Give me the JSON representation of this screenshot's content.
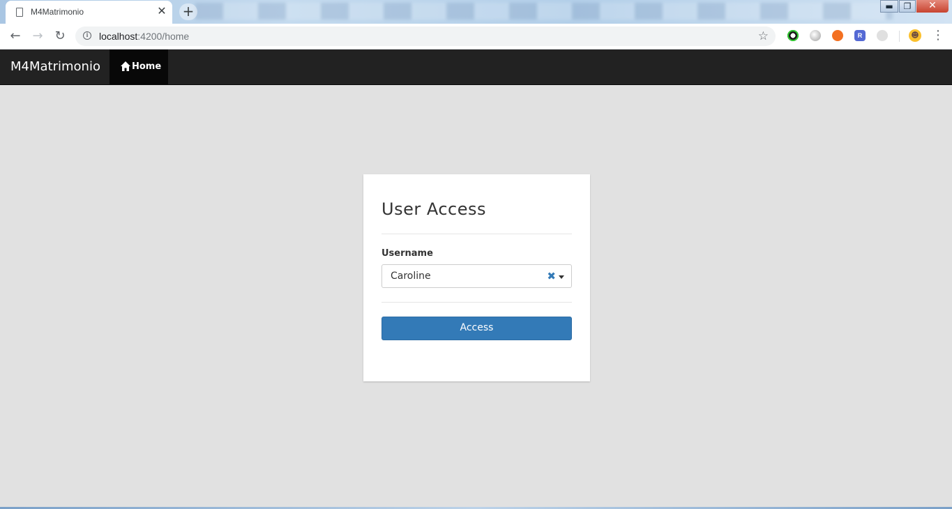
{
  "browser": {
    "tab_title": "M4Matrimonio",
    "tab_close": "✕",
    "new_tab": "+",
    "url_host": "localhost",
    "url_path": ":4200/home",
    "window_controls": {
      "minimize": "▬",
      "maximize": "❐",
      "close": "✕"
    },
    "extensions": [
      "color-picker-icon",
      "circle-extension-icon",
      "orange-extension-icon",
      "r-extension-icon",
      "gray-extension-icon"
    ],
    "ext_r_letter": "R",
    "icons": {
      "back": "←",
      "forward": "→",
      "reload": "↻",
      "star": "☆",
      "menu": "⋮",
      "info": "i",
      "avatar": "☻"
    }
  },
  "navbar": {
    "brand": "M4Matrimonio",
    "home_label": "Home"
  },
  "login_card": {
    "title": "User Access",
    "username_label": "Username",
    "username_value": "Caroline",
    "clear_glyph": "✖",
    "access_button": "Access"
  },
  "colors": {
    "primary": "#337ab7",
    "navbar": "#222222",
    "background": "#e1e1e1"
  }
}
